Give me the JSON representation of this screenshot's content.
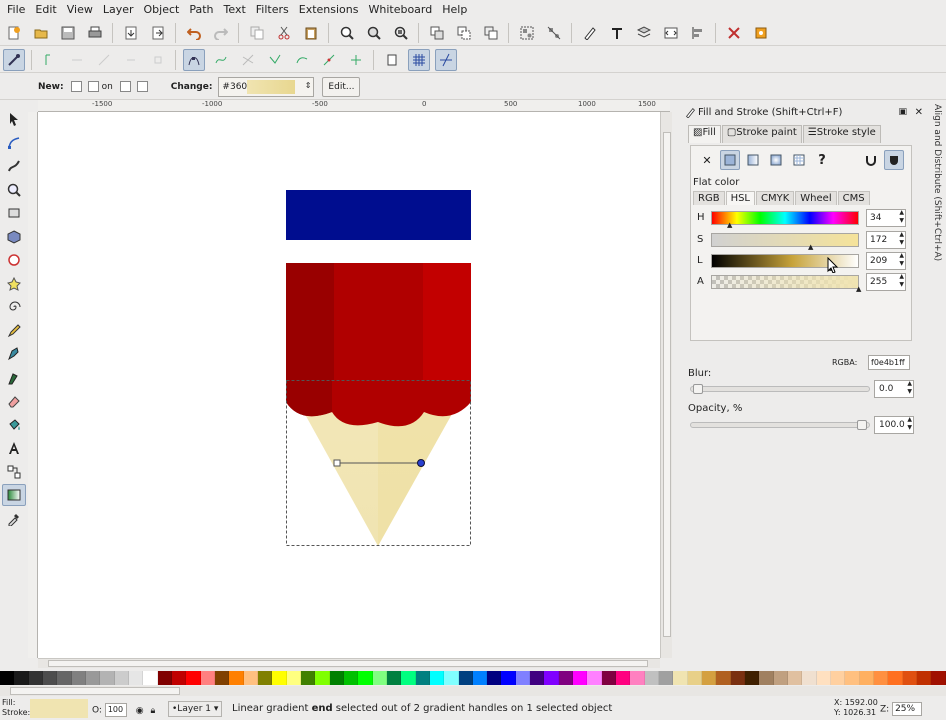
{
  "menu": [
    {
      "label": "File",
      "u": "F"
    },
    {
      "label": "Edit",
      "u": "E"
    },
    {
      "label": "View",
      "u": "V"
    },
    {
      "label": "Layer",
      "u": "L"
    },
    {
      "label": "Object",
      "u": "O"
    },
    {
      "label": "Path",
      "u": "P"
    },
    {
      "label": "Text",
      "u": "T"
    },
    {
      "label": "Filters",
      "u": "r"
    },
    {
      "label": "Extensions",
      "u": "x"
    },
    {
      "label": "Whiteboard",
      "u": "W"
    },
    {
      "label": "Help",
      "u": "H"
    }
  ],
  "gradient_toolbar": {
    "new_label": "New:",
    "on_label": "on",
    "change_label": "Change:",
    "gradient_id": "#3609",
    "edit_label": "Edit..."
  },
  "ruler_ticks": [
    "-1500",
    "-1000",
    "-500",
    "0",
    "500",
    "1000",
    "1500"
  ],
  "dock": {
    "title": "Fill and Stroke (Shift+Ctrl+F)",
    "tabs": [
      "Fill",
      "Stroke paint",
      "Stroke style"
    ],
    "flat_color_label": "Flat color",
    "modes": [
      "RGB",
      "HSL",
      "CMYK",
      "Wheel",
      "CMS"
    ],
    "sliders": [
      {
        "label": "H",
        "value": "34"
      },
      {
        "label": "S",
        "value": "172"
      },
      {
        "label": "L",
        "value": "209"
      },
      {
        "label": "A",
        "value": "255"
      }
    ],
    "rgba_label": "RGBA:",
    "rgba_value": "f0e4b1ff",
    "blur_label": "Blur:",
    "blur_value": "0.0",
    "opacity_label": "Opacity, %",
    "opacity_value": "100.0",
    "side_tab": "Align and Distribute (Shift+Ctrl+A)"
  },
  "palette_colors": [
    "#000000",
    "#1a1a1a",
    "#333333",
    "#4d4d4d",
    "#666666",
    "#808080",
    "#999999",
    "#b3b3b3",
    "#cccccc",
    "#e6e6e6",
    "#ffffff",
    "#800000",
    "#c00000",
    "#ff0000",
    "#ff8080",
    "#804000",
    "#ff8000",
    "#ffc080",
    "#808000",
    "#ffff00",
    "#ffff80",
    "#408000",
    "#80ff00",
    "#008000",
    "#00c000",
    "#00ff00",
    "#80ff80",
    "#008040",
    "#00ff80",
    "#008080",
    "#00ffff",
    "#80ffff",
    "#004080",
    "#0080ff",
    "#000080",
    "#0000ff",
    "#8080ff",
    "#400080",
    "#8000ff",
    "#800080",
    "#ff00ff",
    "#ff80ff",
    "#800040",
    "#ff0080",
    "#ff80c0",
    "#c0c0c0",
    "#a0a0a0",
    "#f0e4b1",
    "#e8d088",
    "#d4a040",
    "#b06020",
    "#7a3010",
    "#402000",
    "#a08060",
    "#c0a080",
    "#e0c0a0",
    "#f0e0d0",
    "#ffe0c0",
    "#ffd0a0",
    "#ffc080",
    "#ffb060",
    "#ff9040",
    "#ff7020",
    "#e05010",
    "#c03000",
    "#a01000"
  ],
  "status": {
    "fill_label": "Fill:",
    "stroke_label": "Stroke:",
    "opacity_label": "O:",
    "opacity_value": "100",
    "layer": "•Layer 1",
    "message_pre": "Linear gradient ",
    "message_bold": "end",
    "message_post": " selected out of 2 gradient handles on 1 selected object",
    "x_coord": "X: 1592.00",
    "y_coord": "Y: 1026.31",
    "zoom_label": "Z:",
    "zoom_value": "25%"
  },
  "colors": {
    "blue_rect": "#000d8f",
    "pencil_red": "#b00000",
    "pencil_light": "#f0e4b1"
  }
}
